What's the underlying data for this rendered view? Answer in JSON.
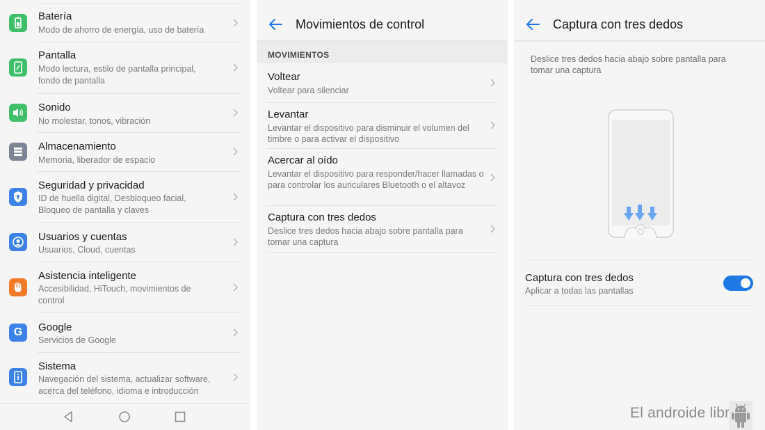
{
  "panel1": {
    "items": [
      {
        "title": "Batería",
        "subtitle": "Modo de ahorro de energía, uso de batería",
        "icon": "battery-icon",
        "color": "#3fbf6a"
      },
      {
        "title": "Pantalla",
        "subtitle": "Modo lectura, estilo de pantalla principal, fondo de pantalla",
        "icon": "display-icon",
        "color": "#3fbf6a"
      },
      {
        "title": "Sonido",
        "subtitle": "No molestar, tonos, vibración",
        "icon": "sound-icon",
        "color": "#3fbf6a"
      },
      {
        "title": "Almacenamiento",
        "subtitle": "Memoria, liberador de espacio",
        "icon": "storage-icon",
        "color": "#7d8494"
      },
      {
        "title": "Seguridad y privacidad",
        "subtitle": "ID de huella digital, Desbloqueo facial, Bloqueo de pantalla y claves",
        "icon": "shield-icon",
        "color": "#3c82e8"
      },
      {
        "title": "Usuarios y cuentas",
        "subtitle": "Usuarios, Cloud, cuentas",
        "icon": "user-icon",
        "color": "#3c82e8"
      },
      {
        "title": "Asistencia inteligente",
        "subtitle": "Accesibilidad, HiTouch, movimientos de control",
        "icon": "hand-icon",
        "color": "#f27b29"
      },
      {
        "title": "Google",
        "subtitle": "Servicios de Google",
        "icon": "google-icon",
        "color": "#3c82e8"
      },
      {
        "title": "Sistema",
        "subtitle": "Navegación del sistema, actualizar software, acerca del teléfono, idioma e introducción",
        "icon": "info-phone-icon",
        "color": "#3c82e8"
      }
    ]
  },
  "panel2": {
    "title": "Movimientos de control",
    "section_label": "MOVIMIENTOS",
    "items": [
      {
        "title": "Voltear",
        "subtitle": "Voltear para silenciar"
      },
      {
        "title": "Levantar",
        "subtitle": "Levantar el dispositivo para disminuir el volumen del timbre o para activar el dispositivo"
      },
      {
        "title": "Acercar al oído",
        "subtitle": "Levantar el dispositivo para responder/hacer llamadas o para controlar los auriculares Bluetooth o el altavoz"
      },
      {
        "title": "Captura con tres dedos",
        "subtitle": "Deslice tres dedos hacia abajo sobre pantalla para tomar una captura"
      }
    ]
  },
  "panel3": {
    "title": "Captura con tres dedos",
    "description": "Deslice tres dedos hacia abajo sobre pantalla para tomar una captura",
    "toggle_title": "Captura con tres dedos",
    "toggle_subtitle": "Aplicar a todas las pantallas",
    "toggle_on": true
  },
  "watermark": "El androide libre",
  "colors": {
    "accent": "#1e78e6",
    "background": "#f5f5f5"
  }
}
